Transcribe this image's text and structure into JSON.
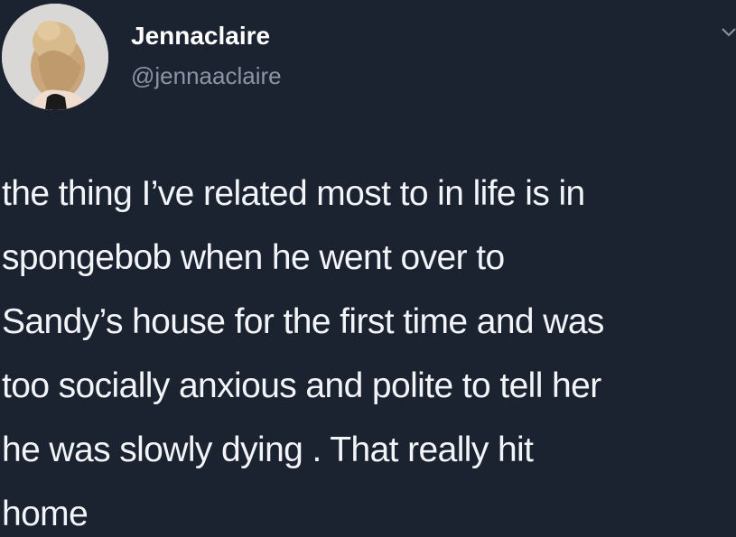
{
  "author": {
    "display_name": "Jennaclaire",
    "handle": "@jennaaclaire",
    "avatar_icon": "profile-photo"
  },
  "menu_icon": "chevron-down-icon",
  "tweet": {
    "lines": [
      "the thing I’ve related most to in life is in",
      "spongebob when he went over to",
      "Sandy’s house for the first time and was",
      "too socially anxious and polite to tell her",
      "he was slowly dying .  That really hit",
      "home"
    ]
  },
  "colors": {
    "background": "#1b2230",
    "text": "#f2f4f7",
    "secondary_text": "#8a96a5"
  }
}
